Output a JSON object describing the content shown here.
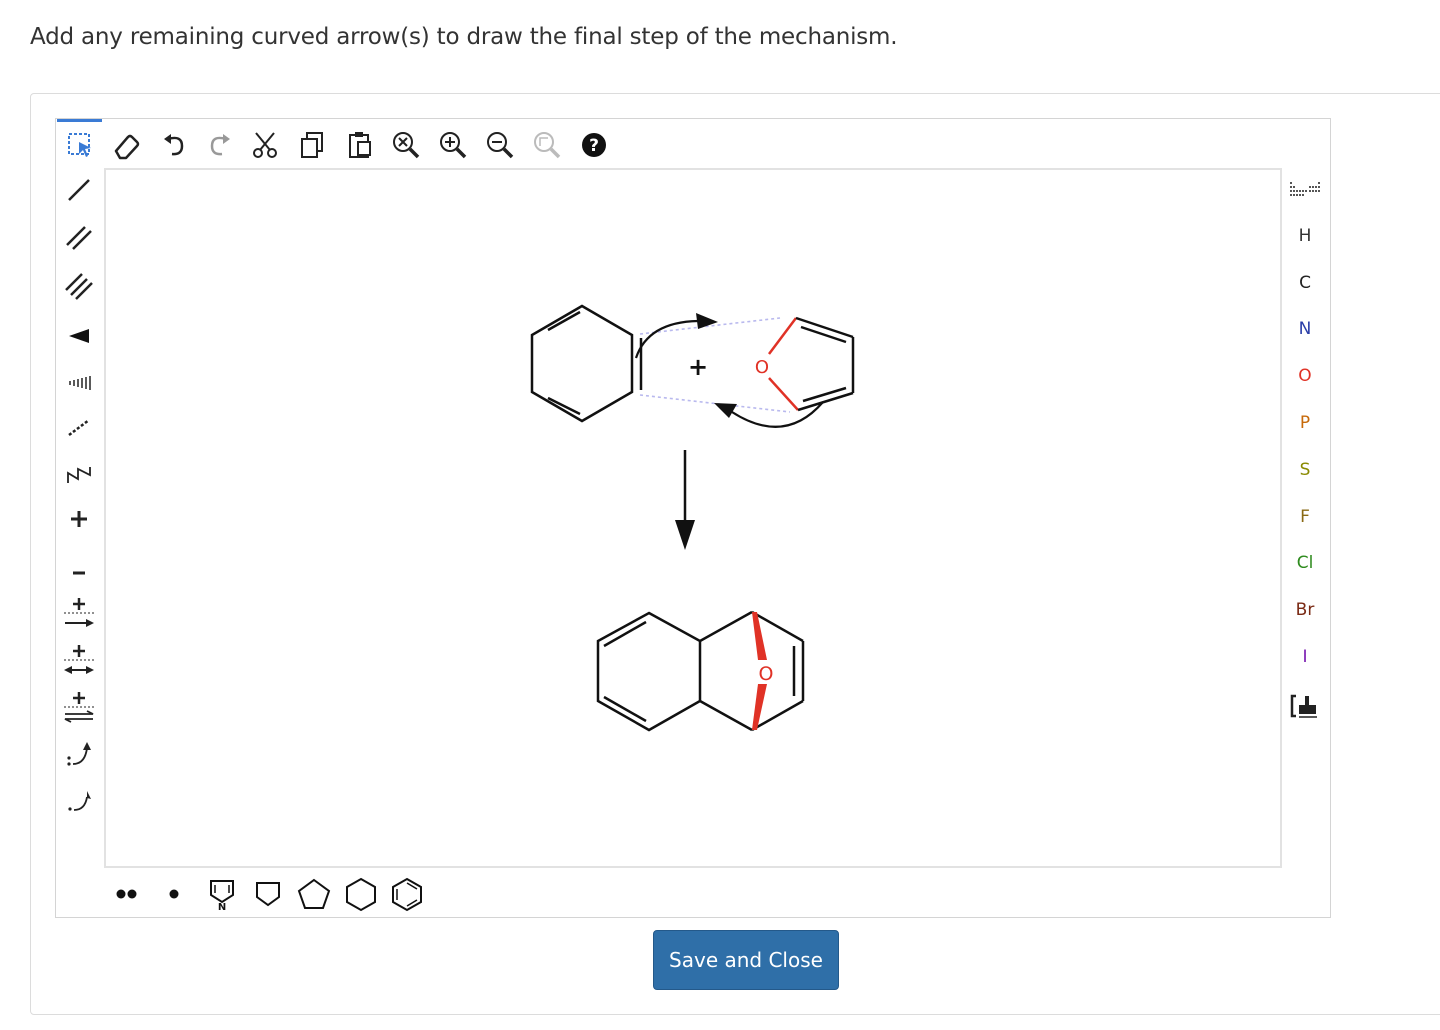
{
  "question": {
    "text": "Add any remaining curved arrow(s) to draw the final step of the mechanism."
  },
  "toolbar_top": [
    {
      "name": "selection-icon"
    },
    {
      "name": "eraser-icon"
    },
    {
      "name": "undo-icon"
    },
    {
      "name": "redo-icon"
    },
    {
      "name": "cut-icon"
    },
    {
      "name": "copy-icon"
    },
    {
      "name": "paste-icon"
    },
    {
      "name": "zoom-reset-icon"
    },
    {
      "name": "zoom-in-icon"
    },
    {
      "name": "zoom-out-icon"
    },
    {
      "name": "clean-icon"
    },
    {
      "name": "help-icon",
      "label": "?"
    }
  ],
  "toolbar_left": [
    {
      "name": "single-bond-icon"
    },
    {
      "name": "double-bond-icon"
    },
    {
      "name": "triple-bond-icon"
    },
    {
      "name": "wedge-bond-icon"
    },
    {
      "name": "hash-bond-icon"
    },
    {
      "name": "dashed-bond-icon"
    },
    {
      "name": "chain-icon"
    },
    {
      "name": "positive-charge-icon",
      "label": "+"
    },
    {
      "name": "negative-charge-icon",
      "label": "−"
    },
    {
      "name": "reaction-arrow-icon",
      "label": "+"
    },
    {
      "name": "resonance-arrow-icon",
      "label": "+"
    },
    {
      "name": "equilibrium-arrow-icon",
      "label": "+"
    },
    {
      "name": "electron-pair-arrow-icon"
    },
    {
      "name": "single-electron-arrow-icon"
    }
  ],
  "elements": [
    {
      "symbol": "H",
      "color": "#333333"
    },
    {
      "symbol": "C",
      "color": "#222222"
    },
    {
      "symbol": "N",
      "color": "#2a3ea8"
    },
    {
      "symbol": "O",
      "color": "#e03226"
    },
    {
      "symbol": "P",
      "color": "#c76a0a"
    },
    {
      "symbol": "S",
      "color": "#8a8a00"
    },
    {
      "symbol": "F",
      "color": "#8a6a14"
    },
    {
      "symbol": "Cl",
      "color": "#2e8b1e"
    },
    {
      "symbol": "Br",
      "color": "#7a2a14"
    },
    {
      "symbol": "I",
      "color": "#7a1ab0"
    }
  ],
  "toolbar_bottom": [
    {
      "name": "lone-pair-icon"
    },
    {
      "name": "radical-icon"
    },
    {
      "name": "pyrrole-template-icon",
      "label": "N"
    },
    {
      "name": "cyclobutane-icon"
    },
    {
      "name": "cyclopentane-icon"
    },
    {
      "name": "cyclohexane-icon"
    },
    {
      "name": "benzene-icon"
    }
  ],
  "canvas": {
    "plus_label": "+",
    "oxygen_label": "O",
    "oxygen_color": "#e03226"
  },
  "save_button": {
    "label": "Save and Close"
  }
}
